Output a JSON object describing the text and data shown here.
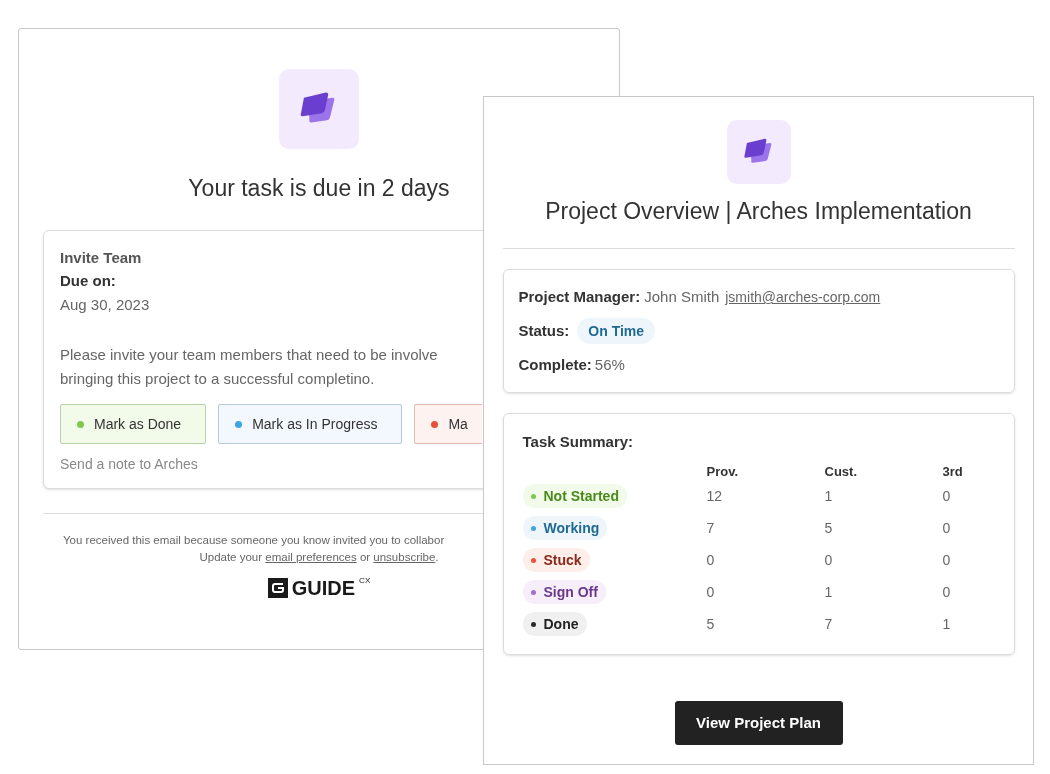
{
  "reminder_email": {
    "title": "Your task is due in 2 days",
    "task": {
      "name": "Invite Team",
      "due_label": "Due on:",
      "due_date": "Aug 30, 2023",
      "description_lines": [
        "Please invite your team members that need to be involve",
        "bringing this project to a successful completino."
      ]
    },
    "actions": [
      {
        "label": "Mark as Done",
        "color": "#7ec850",
        "kind": "done"
      },
      {
        "label": "Mark as In Progress",
        "color": "#3ea5e0",
        "kind": "progress"
      },
      {
        "label": "Ma",
        "color": "#e8503a",
        "kind": "stuck"
      }
    ],
    "note_link": "Send a note to Arches",
    "footer": {
      "line_1": "You received this email because someone you know invited you to collabor",
      "line_2_parts": [
        "Update your ",
        "email preferences",
        " or ",
        "unsubscribe",
        "."
      ],
      "brand": "GUIDE",
      "brand_suffix": "CX"
    }
  },
  "overview_email": {
    "title": "Project Overview | Arches Implementation",
    "details": {
      "manager_label": "Project Manager:",
      "manager_name": "John Smith",
      "manager_email": "jsmith@arches-corp.com",
      "status_label": "Status:",
      "status": "On Time",
      "complete_label": "Complete:",
      "complete": "56%"
    },
    "task_summary": {
      "title": "Task Summary:",
      "columns": [
        "Prov.",
        "Cust.",
        "3rd"
      ],
      "rows": [
        {
          "status": "Not Started",
          "color": "#7ec850",
          "values": [
            "12",
            "1",
            "0"
          ]
        },
        {
          "status": "Working",
          "color": "#3ea5e0",
          "values": [
            "7",
            "5",
            "0"
          ]
        },
        {
          "status": "Stuck",
          "color": "#e8503a",
          "values": [
            "0",
            "0",
            "0"
          ]
        },
        {
          "status": "Sign Off",
          "color": "#a070d0",
          "values": [
            "0",
            "1",
            "0"
          ]
        },
        {
          "status": "Done",
          "color": "#2a2a2a",
          "values": [
            "5",
            "7",
            "1"
          ]
        }
      ]
    },
    "button": "View Project Plan"
  }
}
